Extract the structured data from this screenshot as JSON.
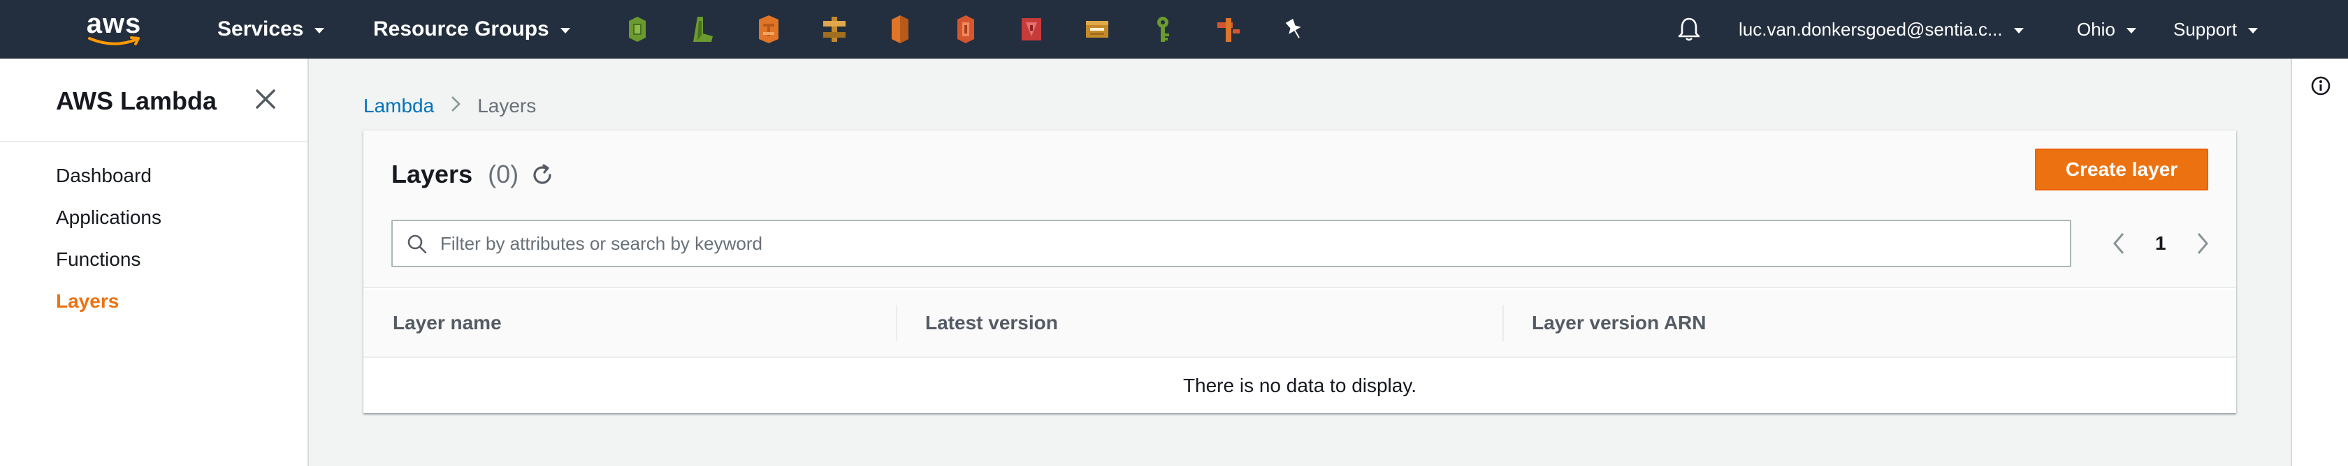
{
  "topnav": {
    "logo_text": "aws",
    "services_label": "Services",
    "resource_groups_label": "Resource Groups",
    "pinned_services": [
      {
        "icon": "ec2-icon",
        "color": "#6b9a2e"
      },
      {
        "icon": "elastic-beanstalk-icon",
        "color": "#6b9a2e"
      },
      {
        "icon": "lambda-service-icon",
        "color": "#e07528"
      },
      {
        "icon": "step-functions-icon",
        "color": "#c48a2a"
      },
      {
        "icon": "aws-service-icon",
        "color": "#e07528"
      },
      {
        "icon": "aws-service-icon",
        "color": "#d5562e"
      },
      {
        "icon": "aws-service-icon",
        "color": "#c73b3b"
      },
      {
        "icon": "aws-service-icon",
        "color": "#c48a2a"
      },
      {
        "icon": "iam-icon",
        "color": "#6b9a2e"
      },
      {
        "icon": "api-gateway-icon",
        "color": "#d5562e"
      },
      {
        "icon": "pin-icon",
        "color": "#ffffff"
      }
    ],
    "account_label": "luc.van.donkersgoed@sentia.c...",
    "region_label": "Ohio",
    "support_label": "Support"
  },
  "sidenav": {
    "title": "AWS Lambda",
    "items": [
      {
        "label": "Dashboard",
        "active": false
      },
      {
        "label": "Applications",
        "active": false
      },
      {
        "label": "Functions",
        "active": false
      },
      {
        "label": "Layers",
        "active": true
      }
    ]
  },
  "breadcrumb": {
    "root": "Lambda",
    "current": "Layers"
  },
  "layers": {
    "title": "Layers",
    "count": "(0)",
    "create_button": "Create layer",
    "filter_placeholder": "Filter by attributes or search by keyword",
    "page_number": "1",
    "columns": [
      "Layer name",
      "Latest version",
      "Layer version ARN"
    ],
    "rows": [],
    "empty_message": "There is no data to display."
  },
  "colors": {
    "nav_bg": "#232f3e",
    "accent": "#ec7211",
    "link": "#0073bb"
  }
}
